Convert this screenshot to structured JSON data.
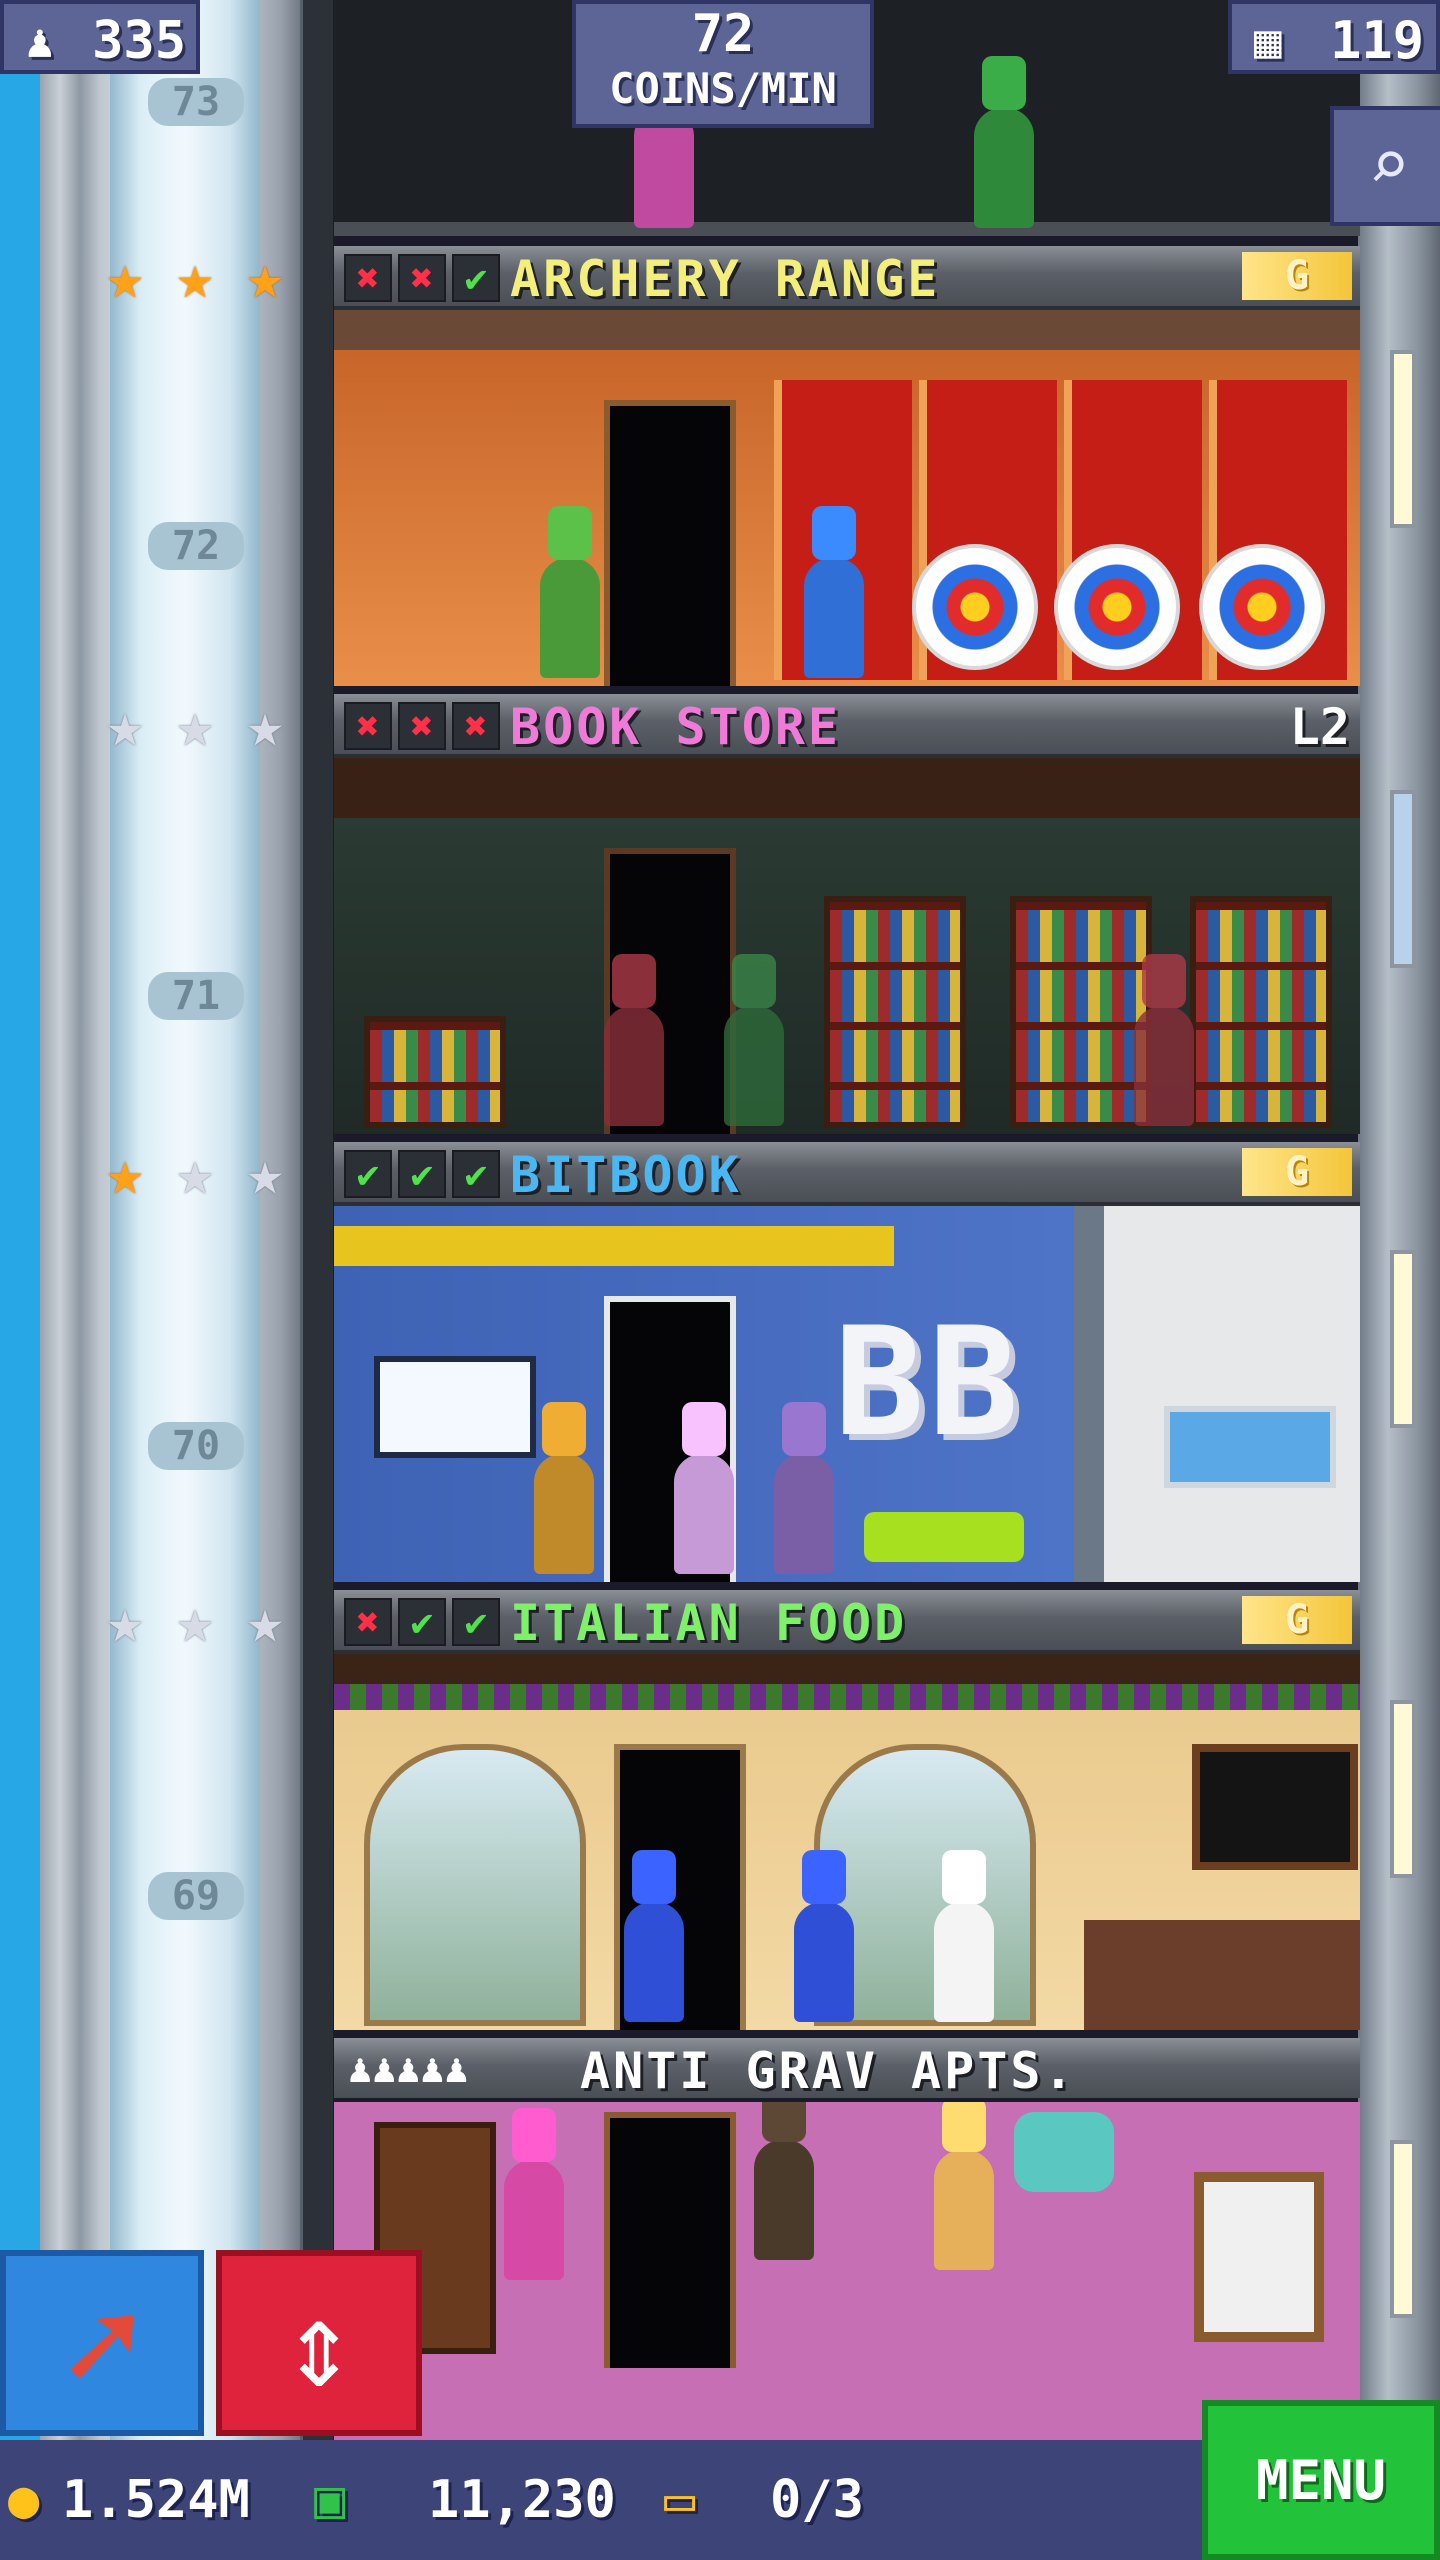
{
  "hud": {
    "population": "335",
    "coins_per_min_value": "72",
    "coins_per_min_unit": "COINS/MIN",
    "bux": "119"
  },
  "floors": [
    {
      "number": "73"
    },
    {
      "number": "72",
      "name": "ARCHERY RANGE",
      "name_color": "#f4ef7a",
      "checks": [
        "no",
        "no",
        "ok"
      ],
      "stars": [
        "gold",
        "gold",
        "gold"
      ],
      "tag": "G"
    },
    {
      "number": "71",
      "name": "BOOK STORE",
      "name_color": "#f07ad8",
      "checks": [
        "no",
        "no",
        "no"
      ],
      "stars": [
        "silver",
        "silver",
        "silver"
      ],
      "level": "L2"
    },
    {
      "number": "70",
      "name": "BITBOOK",
      "name_color": "#49b8f2",
      "checks": [
        "ok",
        "ok",
        "ok"
      ],
      "stars": [
        "gold",
        "silver",
        "silver"
      ],
      "tag": "G"
    },
    {
      "number": "69",
      "name": "ITALIAN FOOD",
      "name_color": "#7ef06a",
      "checks": [
        "no",
        "ok",
        "ok"
      ],
      "stars": [
        "silver",
        "silver",
        "silver"
      ],
      "tag": "G"
    },
    {
      "name": "ANTI GRAV APTS.",
      "residents": "♟♟♟♟♟"
    }
  ],
  "bottom": {
    "coins": "1.524M",
    "bux": "11,230",
    "tickets": "0/3",
    "menu_label": "MENU"
  },
  "colors": {
    "hud_bg": "#5d6597",
    "menu_green": "#22c33a",
    "elevator_red": "#e0233d",
    "arrow_blue": "#2f87e0"
  },
  "icons": [
    "person-icon",
    "building-icon",
    "search-icon",
    "arrow-icon",
    "elevator-icon",
    "coin-icon",
    "bux-icon",
    "ticket-icon",
    "star-icon",
    "check-icon",
    "cross-icon"
  ]
}
